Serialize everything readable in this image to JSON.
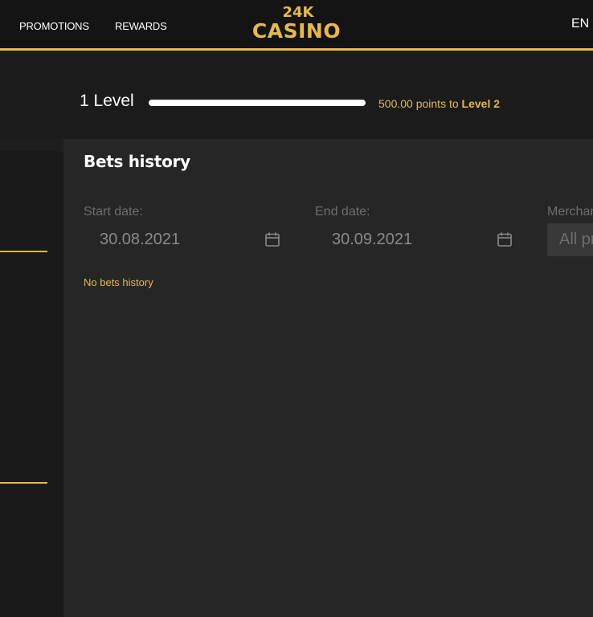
{
  "header": {
    "nav": {
      "promotions": "PROMOTIONS",
      "rewards": "REWARDS"
    },
    "logo": {
      "top": "24K",
      "bottom": "CASINO"
    },
    "language": "EN"
  },
  "level": {
    "title": "1 Level",
    "progress_percent": 100,
    "points_prefix": "500.00 points to",
    "next_level": "Level 2"
  },
  "bets_history": {
    "title": "Bets history",
    "start_date": {
      "label": "Start date:",
      "value": "30.08.2021"
    },
    "end_date": {
      "label": "End date:",
      "value": "30.09.2021"
    },
    "merchant": {
      "label": "Merchant:",
      "value": "All providers"
    },
    "empty_message": "No bets history"
  },
  "colors": {
    "accent": "#e6b94a",
    "background": "#262626",
    "header": "#141414"
  },
  "icons": [
    "calendar-icon"
  ]
}
